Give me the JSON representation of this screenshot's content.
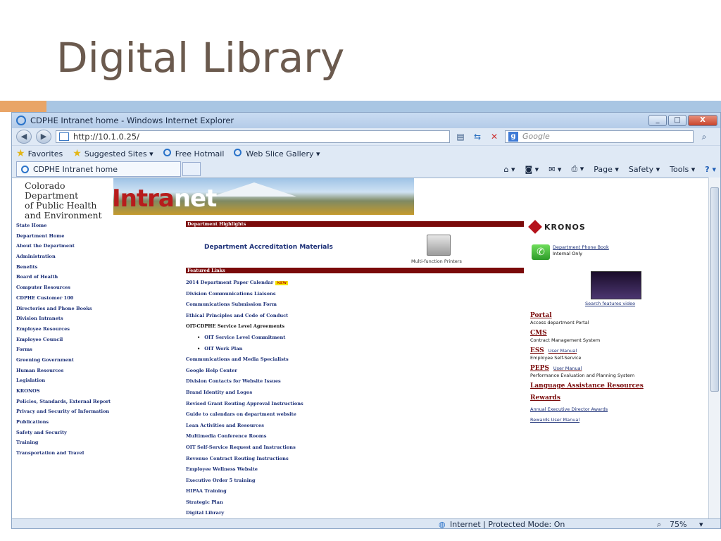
{
  "slide": {
    "title": "Digital Library"
  },
  "browser": {
    "window_title": "CDPHE Intranet home - Windows Internet Explorer",
    "window_buttons": {
      "minimize": "_",
      "maximize": "□",
      "close": "X"
    },
    "address": "http://10.1.0.25/",
    "search_placeholder": "Google",
    "favorites": {
      "favorites_label": "Favorites",
      "suggested": "Suggested Sites ▾",
      "hotmail": "Free Hotmail",
      "webslice": "Web Slice Gallery ▾"
    },
    "tab_title": "CDPHE Intranet home",
    "commands": {
      "page": "Page ▾",
      "safety": "Safety ▾",
      "tools": "Tools ▾",
      "help": "? ▾"
    },
    "status": {
      "zone": "Internet | Protected Mode: On",
      "zoom": "75%"
    }
  },
  "site": {
    "dept_name_lines": [
      "Colorado Department",
      "of Public Health",
      "and Environment"
    ],
    "intranet_logo_a": "Intra",
    "intranet_logo_b": "net",
    "left_nav": [
      "State Home",
      "Department Home",
      "About the Department",
      "Administration",
      "Benefits",
      "Board of Health",
      "Computer Resources",
      "CDPHE Customer 100",
      "Directories and Phone Books",
      "Division Intranets",
      "Employee Resources",
      "Employee Council",
      "Forms",
      "Greening Government",
      "Human Resources",
      "Legislation",
      "KRONOS",
      "Policies, Standards, External Report",
      "Privacy and Security of Information",
      "Publications",
      "Safety and Security",
      "Training",
      "Transportation and Travel"
    ],
    "highlights_header": "Department Highlights",
    "accreditation": "Department Accreditation Materials",
    "printer_caption": "Multi-function Printers",
    "featured_header": "Featured Links",
    "featured_new_badge": "NEW",
    "featured_links": [
      "2014 Department Paper Calendar",
      "Division Communications Liaisons",
      "Communications Submission Form",
      "Ethical Principles and Code of Conduct",
      "OIT-CDPHE Service Level Agreements",
      "OIT Service Level Commitment",
      "OIT Work Plan",
      "Communications and Media Specialists",
      "Google Help Center",
      "Division Contacts for Website Issues",
      "Brand Identity and Logos",
      "Revised Grant Routing Approval Instructions",
      "Guide to calendars on department website",
      "Lean Activities and Resources",
      "Multimedia Conference Rooms",
      "OIT Self-Service Request  and   Instructions",
      "Revenue Contract Routing Instructions",
      "Employee Wellness Website",
      "Executive Order 5 training",
      "HIPAA Training",
      "Strategic Plan",
      "Digital Library"
    ],
    "kronos": "KRONOS",
    "phone_book": "Department Phone Book",
    "internal_only": "Internal Only",
    "video_caption": "Search features video",
    "portal": {
      "title": "Portal",
      "desc": "Access department Portal"
    },
    "cms": {
      "title": "CMS",
      "desc": "Contract Management System"
    },
    "ess": {
      "title": "ESS",
      "manual": "User Manual",
      "desc": "Employee Self-Service"
    },
    "peps": {
      "title": "PEPS",
      "manual": "User Manual",
      "desc": "Performance Evaluation and Planning System"
    },
    "language": "Language Assistance Resources",
    "rewards": {
      "title": "Rewards",
      "awards": "Annual Executive Director Awards",
      "manual": "Rewards User Manual"
    }
  }
}
